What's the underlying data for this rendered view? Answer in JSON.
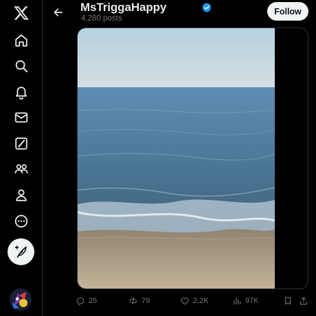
{
  "sidebar": {
    "logo": "x-logo-icon",
    "items": [
      {
        "name": "home",
        "icon": "home-icon"
      },
      {
        "name": "explore",
        "icon": "search-icon"
      },
      {
        "name": "notifications",
        "icon": "bell-icon"
      },
      {
        "name": "messages",
        "icon": "envelope-icon"
      },
      {
        "name": "grok",
        "icon": "grok-icon"
      },
      {
        "name": "communities",
        "icon": "people-icon"
      },
      {
        "name": "profile",
        "icon": "person-icon"
      },
      {
        "name": "more",
        "icon": "more-circle-icon"
      }
    ],
    "compose_icon": "feather-plus-icon",
    "account_avatar": "avatar-image"
  },
  "header": {
    "back_icon": "arrow-left-icon",
    "name": "MsTriggaHappy",
    "verified_icon": "verified-badge-icon",
    "post_count": "4,280 posts",
    "follow_label": "Follow"
  },
  "media": {
    "kind": "photo",
    "scene": "beach placeholder (subject not depicted)"
  },
  "actions": {
    "replies": "25",
    "reposts": "79",
    "likes": "2.2K",
    "views": "97K",
    "bookmark_icon": "bookmark-icon",
    "share_icon": "share-icon"
  },
  "colors": {
    "background": "#000000",
    "text_primary": "#e7e9ea",
    "text_secondary": "#71767b",
    "verified": "#1d9bf0",
    "follow_button": "#eff3f4",
    "border": "#2f3336"
  }
}
